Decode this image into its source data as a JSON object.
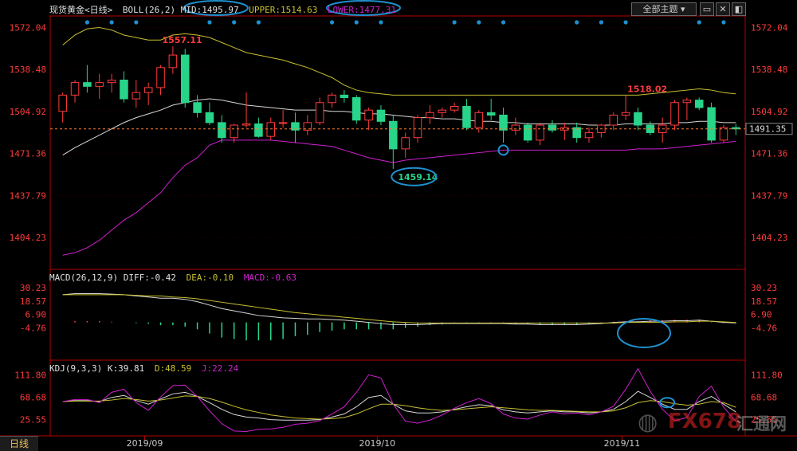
{
  "header": {
    "instrument": "现货黄金<日线>",
    "boll_label": "BOLL(26,2)",
    "mid": "MID:1495.97",
    "upper": "UPPER:1514.63",
    "lower": "LOWER:1477.31",
    "macd_label": "MACD(26,12,9)",
    "diff": "DIFF:-0.42",
    "dea": "DEA:-0.10",
    "macd": "MACD:-0.63",
    "kdj_label": "KDJ(9,3,3)",
    "k": "K:39.81",
    "d": "D:48.59",
    "j": "J:22.24",
    "theme_button": "全部主题",
    "last_price": "1491.35",
    "bottom_tab": "日线",
    "watermark_fx": "FX678",
    "watermark_cn": "汇通网"
  },
  "colors": {
    "up": "#ff3b3b",
    "down": "#28d48a",
    "mid": "#d8d8d8",
    "upper": "#c8c030",
    "lower": "#d020d0",
    "highlight": "#1e90d0",
    "axis": "#b40000",
    "label": "#ff3b3b"
  },
  "chart_data": [
    {
      "type": "candlestick",
      "title": "现货黄金 BOLL(26,2)",
      "ylim": [
        1380,
        1580
      ],
      "y_ticks": [
        1572.04,
        1538.48,
        1504.92,
        1471.36,
        1437.79,
        1404.23
      ],
      "x_ticks": [
        "2019/09",
        "2019/10",
        "2019/11"
      ],
      "annotations": [
        {
          "text": "1557.11",
          "index": 8,
          "value": 1557.11
        },
        {
          "text": "1459.14",
          "index": 27,
          "value": 1459.14
        },
        {
          "text": "1518.02",
          "index": 46,
          "value": 1518.02
        }
      ],
      "ohlc": [
        [
          1505,
          1520,
          1496,
          1518
        ],
        [
          1518,
          1530,
          1512,
          1528
        ],
        [
          1528,
          1542,
          1520,
          1525
        ],
        [
          1525,
          1535,
          1515,
          1528
        ],
        [
          1528,
          1535,
          1520,
          1530
        ],
        [
          1530,
          1537,
          1512,
          1515
        ],
        [
          1515,
          1530,
          1508,
          1520
        ],
        [
          1520,
          1528,
          1510,
          1524
        ],
        [
          1524,
          1542,
          1518,
          1540
        ],
        [
          1540,
          1557,
          1535,
          1550
        ],
        [
          1550,
          1555,
          1508,
          1512
        ],
        [
          1512,
          1518,
          1500,
          1504
        ],
        [
          1504,
          1512,
          1494,
          1496
        ],
        [
          1496,
          1502,
          1480,
          1484
        ],
        [
          1484,
          1495,
          1480,
          1494
        ],
        [
          1494,
          1520,
          1492,
          1495
        ],
        [
          1495,
          1500,
          1484,
          1485
        ],
        [
          1485,
          1500,
          1482,
          1496
        ],
        [
          1496,
          1506,
          1492,
          1496
        ],
        [
          1496,
          1504,
          1480,
          1490
        ],
        [
          1490,
          1502,
          1486,
          1496
        ],
        [
          1496,
          1516,
          1494,
          1512
        ],
        [
          1512,
          1520,
          1508,
          1518
        ],
        [
          1518,
          1522,
          1512,
          1516
        ],
        [
          1516,
          1518,
          1495,
          1498
        ],
        [
          1498,
          1508,
          1490,
          1506
        ],
        [
          1506,
          1510,
          1494,
          1497
        ],
        [
          1497,
          1502,
          1459,
          1475
        ],
        [
          1475,
          1488,
          1468,
          1484
        ],
        [
          1484,
          1502,
          1480,
          1500
        ],
        [
          1500,
          1510,
          1495,
          1504
        ],
        [
          1504,
          1508,
          1500,
          1506
        ],
        [
          1506,
          1512,
          1504,
          1509
        ],
        [
          1509,
          1515,
          1490,
          1492
        ],
        [
          1492,
          1506,
          1488,
          1504
        ],
        [
          1504,
          1515,
          1498,
          1502
        ],
        [
          1502,
          1508,
          1480,
          1490
        ],
        [
          1490,
          1500,
          1486,
          1494
        ],
        [
          1494,
          1496,
          1480,
          1482
        ],
        [
          1482,
          1496,
          1478,
          1494
        ],
        [
          1494,
          1498,
          1488,
          1490
        ],
        [
          1490,
          1496,
          1482,
          1492
        ],
        [
          1492,
          1496,
          1480,
          1484
        ],
        [
          1484,
          1492,
          1480,
          1488
        ],
        [
          1488,
          1495,
          1484,
          1494
        ],
        [
          1494,
          1504,
          1490,
          1502
        ],
        [
          1502,
          1518,
          1498,
          1504
        ],
        [
          1504,
          1508,
          1490,
          1494
        ],
        [
          1494,
          1497,
          1486,
          1488
        ],
        [
          1488,
          1500,
          1480,
          1494
        ],
        [
          1494,
          1514,
          1490,
          1512
        ],
        [
          1512,
          1516,
          1498,
          1514
        ],
        [
          1514,
          1516,
          1506,
          1508
        ],
        [
          1508,
          1512,
          1480,
          1482
        ],
        [
          1482,
          1494,
          1480,
          1492
        ],
        [
          1492,
          1495,
          1486,
          1491
        ]
      ],
      "series": [
        {
          "name": "MID",
          "values": [
            1470,
            1476,
            1481,
            1486,
            1491,
            1496,
            1500,
            1503,
            1506,
            1510,
            1512,
            1514,
            1515,
            1514,
            1512,
            1510,
            1509,
            1508,
            1507,
            1506,
            1506,
            1506,
            1505,
            1505,
            1504,
            1503,
            1503,
            1502,
            1501,
            1500,
            1500,
            1499,
            1499,
            1498,
            1497,
            1497,
            1496,
            1496,
            1495,
            1495,
            1495,
            1495,
            1495,
            1494,
            1494,
            1494,
            1495,
            1495,
            1495,
            1495,
            1496,
            1496,
            1497,
            1497,
            1496,
            1496
          ]
        },
        {
          "name": "UPPER",
          "values": [
            1558,
            1566,
            1571,
            1572,
            1570,
            1566,
            1564,
            1562,
            1562,
            1566,
            1567,
            1566,
            1564,
            1560,
            1556,
            1552,
            1550,
            1548,
            1546,
            1543,
            1540,
            1536,
            1532,
            1526,
            1522,
            1520,
            1519,
            1518,
            1518,
            1518,
            1518,
            1518,
            1518,
            1518,
            1518,
            1518,
            1518,
            1518,
            1518,
            1518,
            1518,
            1518,
            1518,
            1518,
            1518,
            1518,
            1518,
            1518,
            1519,
            1520,
            1521,
            1522,
            1523,
            1522,
            1520,
            1519
          ]
        },
        {
          "name": "LOWER",
          "values": [
            1390,
            1392,
            1396,
            1402,
            1410,
            1418,
            1424,
            1432,
            1440,
            1452,
            1462,
            1468,
            1478,
            1482,
            1482,
            1482,
            1482,
            1482,
            1481,
            1480,
            1479,
            1478,
            1477,
            1474,
            1471,
            1468,
            1466,
            1464,
            1466,
            1467,
            1468,
            1469,
            1470,
            1471,
            1472,
            1473,
            1474,
            1474,
            1474,
            1474,
            1474,
            1474,
            1474,
            1474,
            1474,
            1474,
            1474,
            1475,
            1475,
            1475,
            1476,
            1477,
            1478,
            1479,
            1480,
            1481
          ]
        }
      ]
    },
    {
      "type": "bar",
      "title": "MACD(26,12,9)",
      "ylim": [
        -30,
        35
      ],
      "y_ticks": [
        30.23,
        18.57,
        6.9,
        -4.76
      ],
      "series": [
        {
          "name": "DIFF",
          "values": [
            24,
            25,
            25,
            25,
            24.5,
            24,
            23,
            22,
            21,
            21,
            20,
            18,
            15,
            12,
            10,
            8,
            6,
            5,
            4,
            3.5,
            3,
            3,
            2.5,
            2,
            1,
            0,
            -1,
            -2,
            -2,
            -2,
            -1.5,
            -1,
            -1,
            -1,
            -1,
            -1,
            -1,
            -1.5,
            -1.5,
            -2,
            -2,
            -2,
            -2,
            -1.5,
            -1,
            0,
            0.5,
            0.5,
            1,
            1,
            1.5,
            1.5,
            2,
            1,
            0,
            -0.42
          ]
        },
        {
          "name": "DEA",
          "values": [
            24,
            24,
            24,
            24,
            24,
            24,
            23.5,
            23,
            23,
            22,
            21.5,
            20.5,
            19,
            17.5,
            16,
            14.5,
            13,
            11.5,
            10,
            8.5,
            7.5,
            6.5,
            5.5,
            4.5,
            3.5,
            2.5,
            1.5,
            0.5,
            0,
            -0.5,
            -0.5,
            -0.5,
            -0.5,
            -0.5,
            -0.5,
            -0.5,
            -0.5,
            -0.5,
            -0.5,
            -0.5,
            -0.5,
            -0.5,
            -0.5,
            -0.5,
            -0.5,
            -0.5,
            0,
            0,
            0,
            0,
            0.5,
            0.5,
            1,
            1,
            0.5,
            -0.1
          ]
        },
        {
          "name": "MACD",
          "values": [
            0,
            1,
            1,
            1,
            0.5,
            0,
            -0.5,
            -1,
            -2,
            -2,
            -3,
            -5,
            -8,
            -11,
            -12,
            -13,
            -13,
            -13,
            -12,
            -10,
            -9,
            -7,
            -6,
            -5,
            -5,
            -5,
            -5,
            -5,
            -4,
            -3,
            -2,
            -1.5,
            -1,
            -1,
            -1,
            -1,
            -1,
            -1,
            -1,
            -1.5,
            -1.5,
            -1.5,
            -1.5,
            -1,
            -0.5,
            0.5,
            1,
            1,
            1.5,
            1.5,
            2,
            2,
            2,
            0.5,
            -0.5,
            -0.63
          ]
        }
      ]
    },
    {
      "type": "line",
      "title": "KDJ(9,3,3)",
      "ylim": [
        -5,
        125
      ],
      "y_ticks": [
        111.8,
        68.68,
        25.55
      ],
      "series": [
        {
          "name": "K",
          "values": [
            60,
            62,
            62,
            60,
            68,
            72,
            62,
            55,
            65,
            75,
            78,
            70,
            58,
            45,
            35,
            30,
            28,
            25,
            24,
            24,
            24,
            25,
            30,
            36,
            50,
            68,
            72,
            55,
            42,
            38,
            38,
            40,
            45,
            50,
            54,
            52,
            44,
            40,
            38,
            40,
            42,
            40,
            40,
            38,
            40,
            45,
            60,
            80,
            68,
            55,
            45,
            45,
            60,
            70,
            55,
            40
          ]
        },
        {
          "name": "D",
          "values": [
            60,
            61,
            61,
            61,
            63,
            66,
            64,
            61,
            63,
            67,
            71,
            70,
            66,
            59,
            51,
            44,
            39,
            34,
            31,
            28,
            27,
            26,
            27,
            29,
            36,
            46,
            55,
            55,
            52,
            48,
            45,
            43,
            44,
            46,
            48,
            50,
            48,
            46,
            44,
            43,
            43,
            42,
            41,
            40,
            40,
            42,
            48,
            58,
            62,
            60,
            56,
            53,
            55,
            60,
            58,
            49
          ]
        },
        {
          "name": "J",
          "values": [
            60,
            64,
            64,
            58,
            78,
            84,
            58,
            43,
            69,
            91,
            92,
            70,
            42,
            17,
            3,
            2,
            6,
            7,
            10,
            16,
            18,
            23,
            36,
            50,
            78,
            112,
            106,
            55,
            22,
            18,
            24,
            34,
            47,
            58,
            66,
            56,
            36,
            28,
            26,
            34,
            40,
            36,
            38,
            34,
            40,
            51,
            84,
            124,
            80,
            45,
            23,
            29,
            70,
            90,
            49,
            22
          ]
        }
      ]
    }
  ]
}
